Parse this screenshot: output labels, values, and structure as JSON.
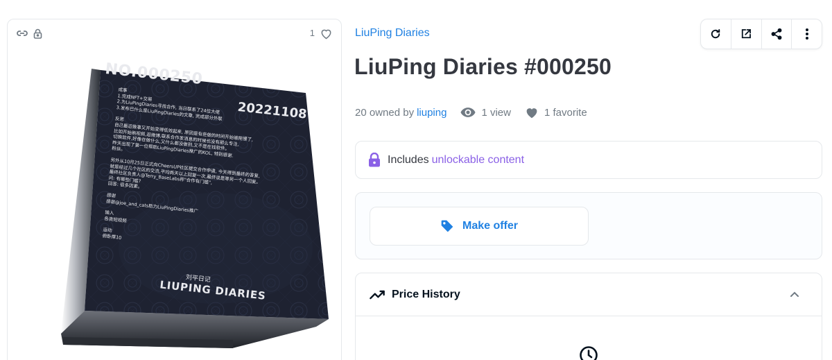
{
  "asset": {
    "collection_name": "LiuPing Diaries",
    "title": "LiuPing Diaries #000250",
    "favorites_count": "1",
    "owned_prefix": "20 owned by",
    "owner": "liuping",
    "views": "1 view",
    "favorites": "1 favorite"
  },
  "unlockable": {
    "prefix": "Includes",
    "link": "unlockable content"
  },
  "actions": {
    "make_offer": "Make offer"
  },
  "price_history": {
    "title": "Price History"
  },
  "artwork": {
    "number": "NO.000250",
    "date": "20221108",
    "sec1_title": "成事",
    "sec1_lines": [
      "1.完成NFT+交易",
      "2.为LiuPingDiaries寻找合作, 当日联系了24位大佬",
      "3.发布已什么是LiuPingDiaries的文章, 完成部分外联"
    ],
    "sec2_title": "反思",
    "sec2_lines": [
      "自己最近做事又开始变得低效起来, 原因是有些做的时间开始被拖慢了,",
      "比如开始刷视频,逛微博,联系合作发消息的时候也没有那么专注,",
      "切换软件,好像在做什么,又什么都没做到,又不是在找软件。",
      "昨天出现了第一位帮助LiuPingDiaries推广的KOL, 特别感谢.",
      "粉丝。"
    ],
    "sec3_lines": [
      "另外从10月25日正式向CheersUP社区提交合作申请, 今天得到最终的答复,",
      "就是经过几个社区的交流,平均两天以上回复一次,最终说是等另一个人回复。",
      "最终社区负责人@Terry_BaseLabs称\"合作有门槛\",",
      "问: 有哪些门槛?",
      "回答: 很多因素。"
    ],
    "sec4_title": "感谢",
    "sec4_lines": [
      "感谢@joe_and_cats助力LiuPingDiaries推广"
    ],
    "sec5_title": "输入",
    "sec5_lines": [
      "各类短视频"
    ],
    "sec6_title": "运动",
    "sec6_lines": [
      "俯卧撑10"
    ],
    "brand_cn": "刘平日记",
    "brand_en": "LIUPING DIARIES"
  },
  "colors": {
    "link_blue": "#2081e2",
    "unlock_purple": "#8a60e6",
    "cube_face": "#1d2230",
    "text_dark": "#353840",
    "text_grey": "#707a83"
  },
  "icons": [
    "link-icon",
    "lock-icon",
    "heart-icon",
    "refresh-icon",
    "external-link-icon",
    "share-icon",
    "more-vertical-icon",
    "eye-icon",
    "tag-icon",
    "trending-icon",
    "chevron-up-icon",
    "clock-icon"
  ]
}
